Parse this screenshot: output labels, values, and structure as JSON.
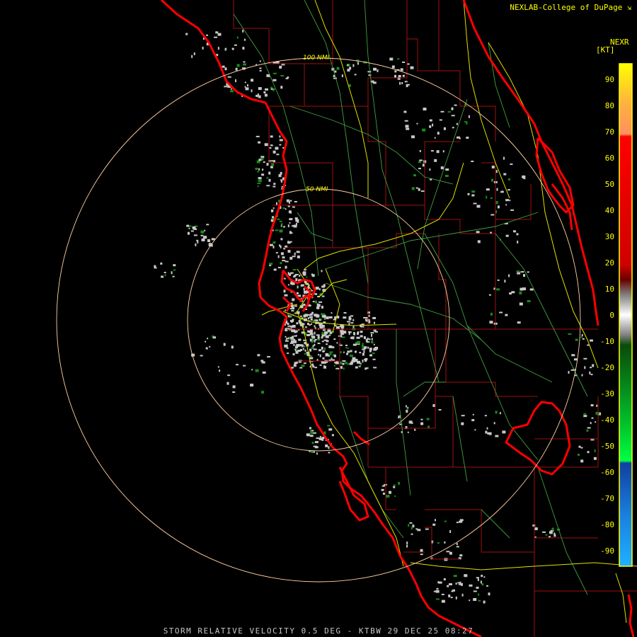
{
  "header": {
    "credit": "NEXLAB-College of DuPage",
    "credit_icon": "expand-icon"
  },
  "footer": {
    "caption": "STORM RELATIVE VELOCITY 0.5 DEG - KTBW 29 DEC 25 08:27"
  },
  "range_rings": [
    {
      "label": "100 NMI"
    },
    {
      "label": "50 NMI"
    }
  ],
  "legend": {
    "title": "NEXR",
    "unit": "[KT]",
    "ticks": [
      "90",
      "80",
      "70",
      "60",
      "50",
      "40",
      "30",
      "20",
      "10",
      "0",
      "-10",
      "-20",
      "-30",
      "-40",
      "-50",
      "-60",
      "-70",
      "-80",
      "-90"
    ],
    "colors": {
      "high_yellow": "#ffff00",
      "orange": "#ffa060",
      "red": "#ff0000",
      "dark_red": "#7a0000",
      "gray": "#c0c0c0",
      "dark_green": "#0a5a0a",
      "green": "#00ff44",
      "blue": "#1560c8",
      "light_blue": "#20a8ff"
    }
  },
  "map_colors": {
    "coast": "#ff0000",
    "county": "#a01010",
    "road": "#40a040",
    "highway": "#e0e000",
    "ring": "#ffd0a0",
    "echo_gray": "#c8c8c8",
    "echo_green": "#1a8a1a"
  }
}
